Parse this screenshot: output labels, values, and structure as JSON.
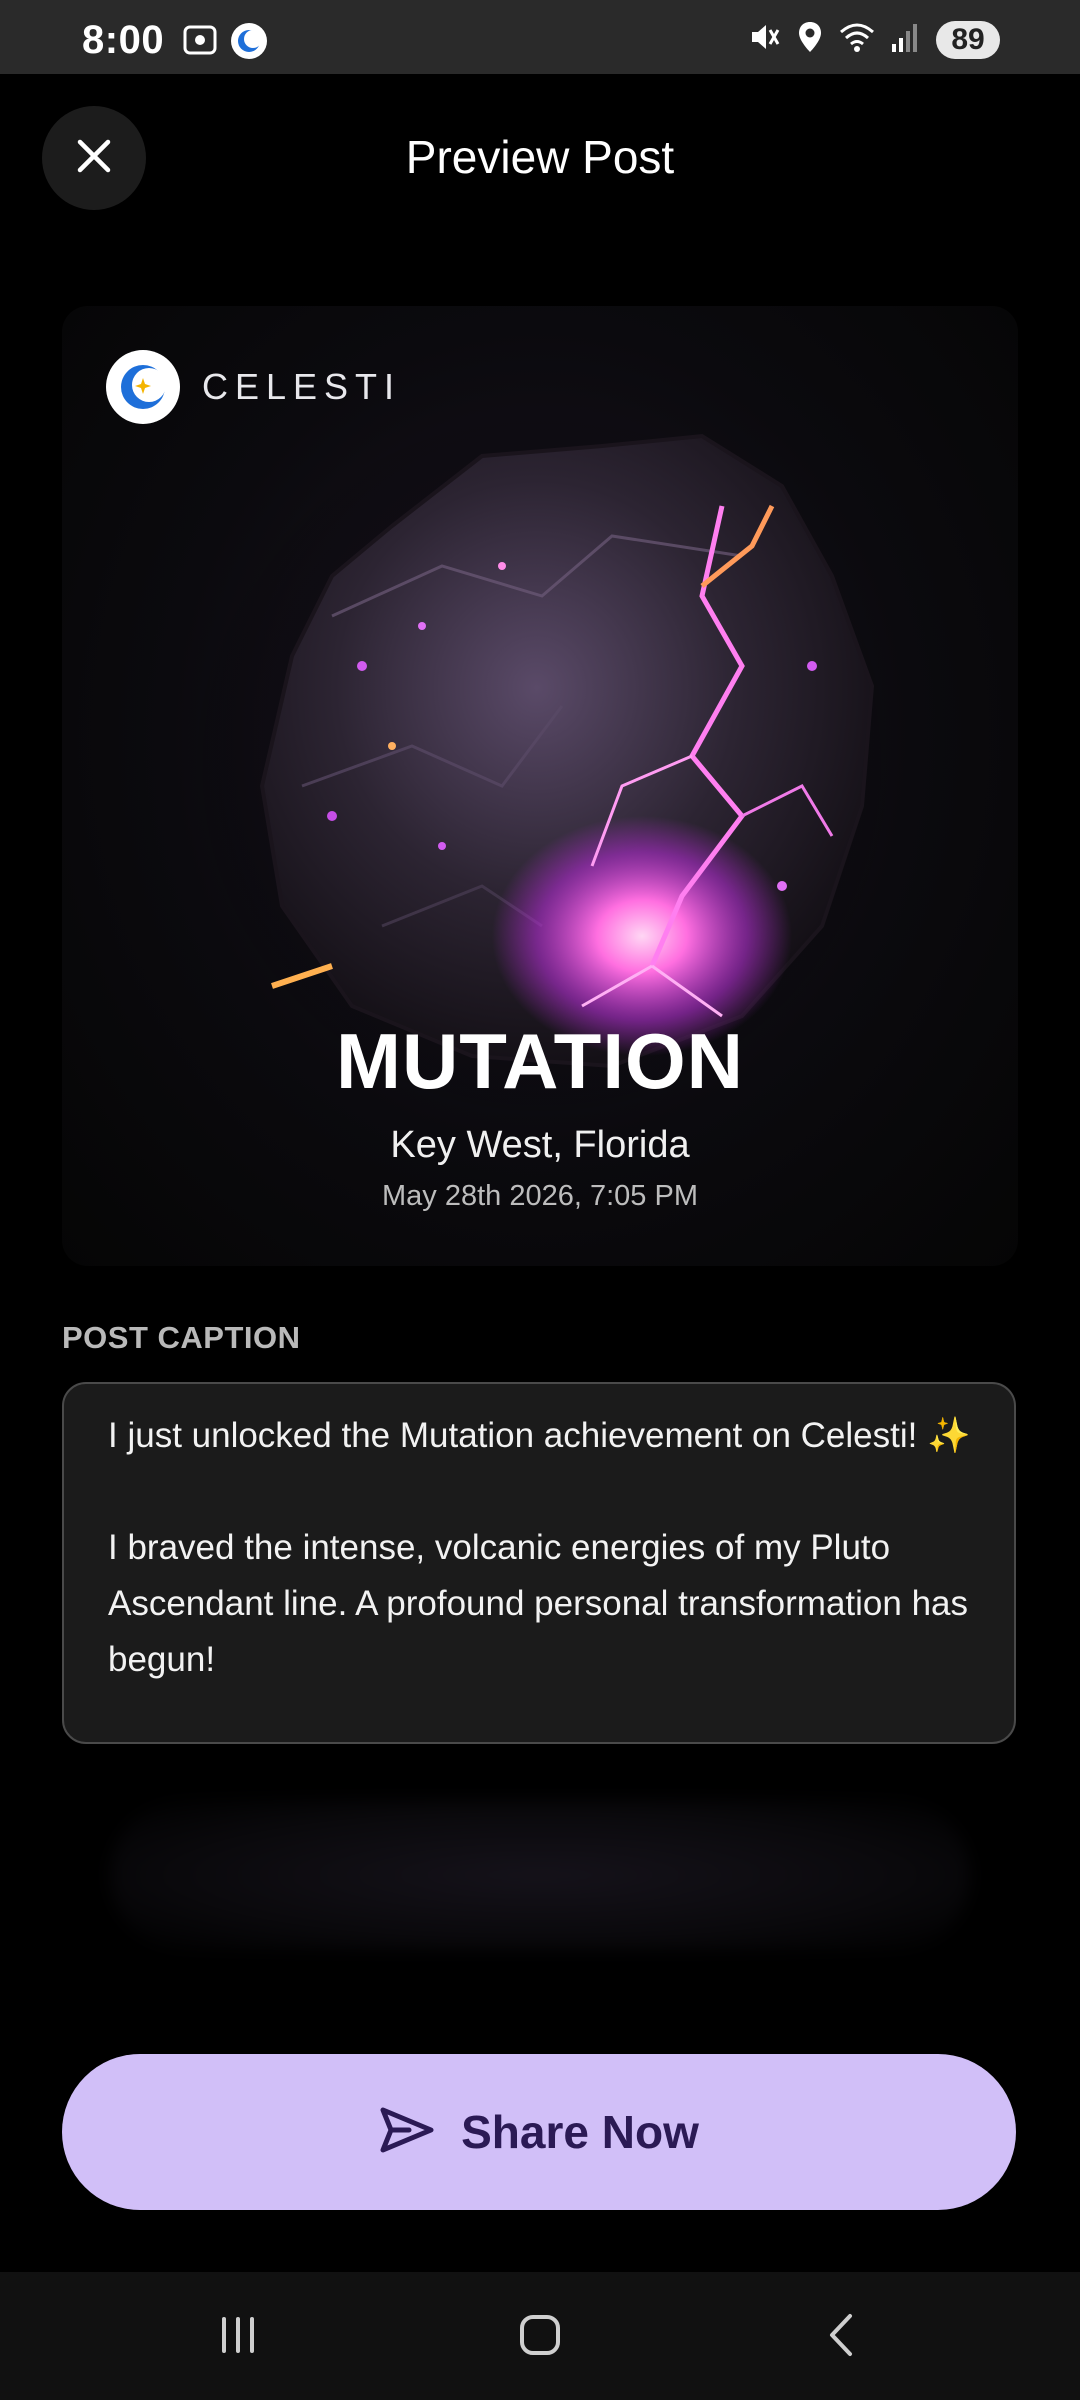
{
  "status_bar": {
    "time": "8:00",
    "battery": "89"
  },
  "header": {
    "title": "Preview Post"
  },
  "card": {
    "brand": "CELESTI",
    "title": "MUTATION",
    "location": "Key West, Florida",
    "date": "May 28th 2026, 7:05 PM"
  },
  "caption": {
    "label": "POST CAPTION",
    "text": "I just unlocked the Mutation achievement on Celesti! ✨\n\nI braved the intense, volcanic energies of my Pluto Ascendant line. A profound personal transformation has begun!"
  },
  "share_button": {
    "label": "Share Now"
  },
  "colors": {
    "accent": "#d1bff8",
    "accent_text": "#2b1a55",
    "background": "#000000"
  },
  "icons": {
    "close": "close-icon",
    "send": "send-icon",
    "recents": "recents-icon",
    "home": "home-icon",
    "back": "back-icon"
  }
}
